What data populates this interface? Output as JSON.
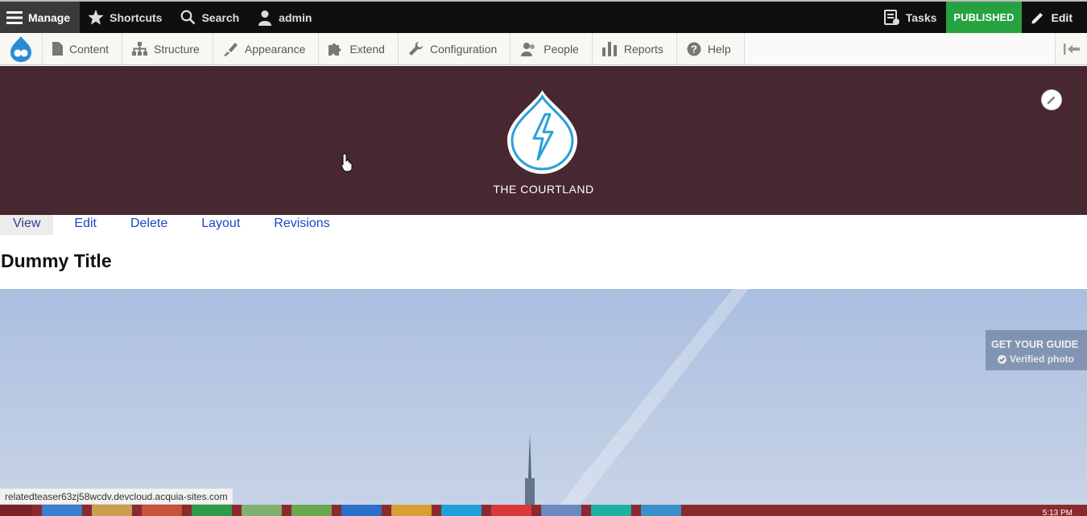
{
  "toolbar": {
    "manage": "Manage",
    "shortcuts": "Shortcuts",
    "search": "Search",
    "user": "admin",
    "tasks": "Tasks",
    "published": "PUBLISHED",
    "edit": "Edit"
  },
  "tray": {
    "items": [
      {
        "label": "Content",
        "icon": "file-icon"
      },
      {
        "label": "Structure",
        "icon": "sitemap-icon"
      },
      {
        "label": "Appearance",
        "icon": "paintbrush-icon"
      },
      {
        "label": "Extend",
        "icon": "puzzle-icon"
      },
      {
        "label": "Configuration",
        "icon": "wrench-icon"
      },
      {
        "label": "People",
        "icon": "people-icon"
      },
      {
        "label": "Reports",
        "icon": "bar-chart-icon"
      },
      {
        "label": "Help",
        "icon": "help-icon"
      }
    ]
  },
  "header": {
    "site_name": "THE COURTLAND",
    "background": "#472830"
  },
  "tabs": [
    {
      "label": "View",
      "active": true
    },
    {
      "label": "Edit",
      "active": false
    },
    {
      "label": "Delete",
      "active": false
    },
    {
      "label": "Layout",
      "active": false
    },
    {
      "label": "Revisions",
      "active": false
    }
  ],
  "page": {
    "title": "Dummy Title"
  },
  "hero": {
    "badge_title": "GET YOUR GUIDE",
    "badge_sub": "Verified photo"
  },
  "status": {
    "url": "relatedteaser63zj58wcdv.devcloud.acquia-sites.com"
  },
  "taskbar": {
    "clock": "5:13 PM"
  }
}
